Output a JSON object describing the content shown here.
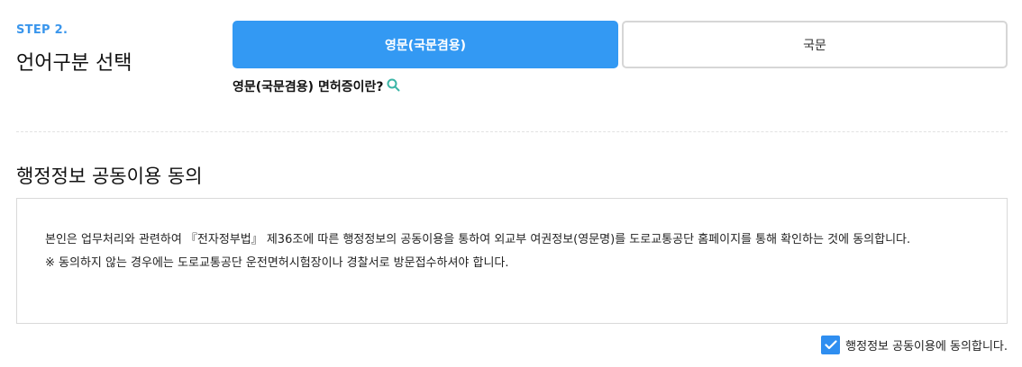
{
  "step": {
    "label": "STEP 2.",
    "title": "언어구분 선택"
  },
  "language": {
    "options": [
      {
        "label": "영문(국문겸용)",
        "selected": true
      },
      {
        "label": "국문",
        "selected": false
      }
    ],
    "info_link": "영문(국문겸용) 면허증이란?",
    "info_icon": "search-icon"
  },
  "consent": {
    "title": "행정정보 공동이용 동의",
    "body_line1": "본인은 업무처리와 관련하여 『전자정부법』 제36조에 따른 행정정보의 공동이용을 통하여 외교부 여권정보(영문명)를 도로교통공단 홈페이지를 통해 확인하는 것에 동의합니다.",
    "body_line2": "※ 동의하지 않는 경우에는 도로교통공단 운전면허시험장이나 경찰서로 방문접수하셔야 합니다.",
    "checkbox_label": "행정정보 공동이용에 동의합니다.",
    "checked": true
  },
  "colors": {
    "accent": "#3399f3",
    "step_label": "#3a96ec",
    "icon": "#3ab5a6"
  }
}
